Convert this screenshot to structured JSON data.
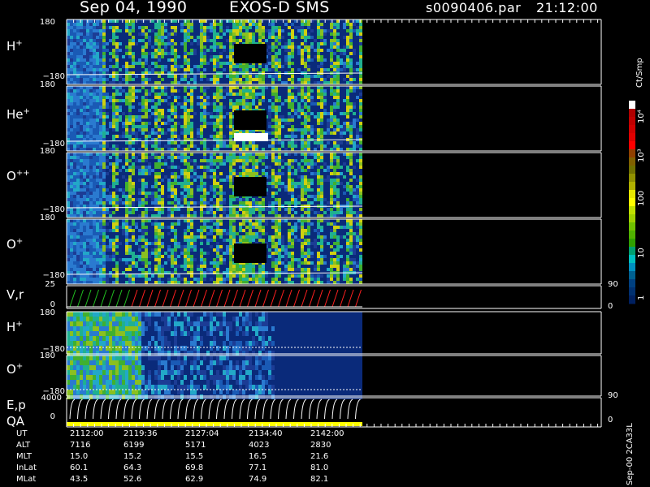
{
  "header": {
    "date": "Sep 04, 1990",
    "instrument": "EXOS-D SMS",
    "file": "s0090406.par",
    "time": "21:12:00"
  },
  "panels": [
    {
      "label": "H",
      "sup": "+",
      "ymax": "180",
      "ymin": "−180"
    },
    {
      "label": "He",
      "sup": "+",
      "ymax": "180",
      "ymin": "−180"
    },
    {
      "label": "O",
      "sup": "++",
      "ymax": "180",
      "ymin": "−180"
    },
    {
      "label": "O",
      "sup": "+",
      "ymax": "180",
      "ymin": "−180"
    },
    {
      "label": "V,r",
      "sup": "",
      "ymax": "25",
      "ymin": "0",
      "rmax": "90",
      "rmin": "0"
    },
    {
      "label": "H",
      "sup": "+",
      "ymax": "180",
      "ymin": "−180"
    },
    {
      "label": "O",
      "sup": "+",
      "ymax": "180",
      "ymin": "−180"
    },
    {
      "label": "E,p",
      "label2": "QA",
      "sup": "",
      "ymax": "4000",
      "ymin": "0",
      "rmax": "90",
      "rmin": "0"
    }
  ],
  "colorbar": {
    "unit": "Ct/Smp",
    "ticks": [
      "10⁴",
      "10³",
      "100",
      "10",
      "1"
    ],
    "colors": [
      "#ffffff",
      "#b00000",
      "#c00000",
      "#d00000",
      "#e00000",
      "#ff0000",
      "#904000",
      "#806000",
      "#707000",
      "#909000",
      "#b0b000",
      "#e8e800",
      "#ffff00",
      "#c0e000",
      "#a0d000",
      "#70c000",
      "#50b000",
      "#30a000",
      "#00a070",
      "#00c0c0",
      "#0090c0",
      "#006090",
      "#004080",
      "#003070",
      "#002060"
    ]
  },
  "footer_note": "Sep-00 2CA33L",
  "chart_data": {
    "type": "heatmap",
    "title": "Sep 04, 1990   EXOS-D SMS   s0090406.par  21:12:00",
    "x_labels": [
      "2112:00",
      "2119:36",
      "2127:04",
      "2134:40",
      "2142:00"
    ],
    "table": [
      {
        "name": "UT",
        "values": [
          "2112:00",
          "2119:36",
          "2127:04",
          "2134:40",
          "2142:00"
        ]
      },
      {
        "name": "ALT",
        "values": [
          "7116",
          "6199",
          "5171",
          "4023",
          "2830"
        ]
      },
      {
        "name": "MLT",
        "values": [
          "15.0",
          "15.2",
          "15.5",
          "16.5",
          "21.6"
        ]
      },
      {
        "name": "InLat",
        "values": [
          "60.1",
          "64.3",
          "69.8",
          "77.1",
          "81.0"
        ]
      },
      {
        "name": "MLat",
        "values": [
          "43.5",
          "52.6",
          "62.9",
          "74.9",
          "82.1"
        ]
      }
    ],
    "series": [
      {
        "name": "H+"
      },
      {
        "name": "He+"
      },
      {
        "name": "O++"
      },
      {
        "name": "O+"
      },
      {
        "name": "V,r"
      },
      {
        "name": "H+"
      },
      {
        "name": "O+"
      },
      {
        "name": "E,p"
      }
    ]
  }
}
